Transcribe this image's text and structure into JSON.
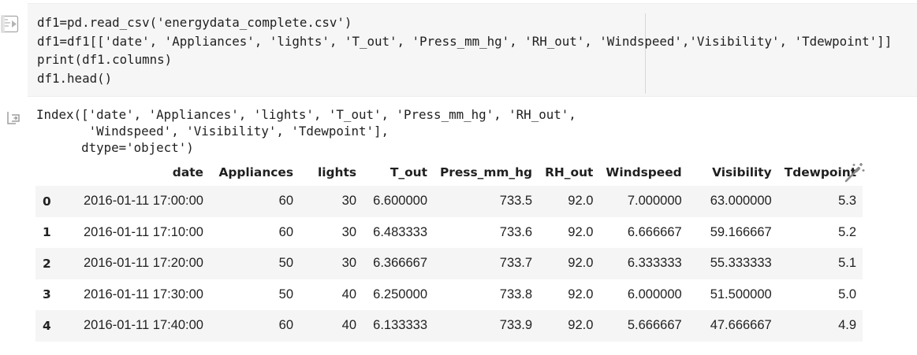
{
  "code_cell": {
    "lines": [
      "df1=pd.read_csv('energydata_complete.csv')",
      "df1=df1[['date', 'Appliances', 'lights', 'T_out', 'Press_mm_hg', 'RH_out', 'Windspeed','Visibility', 'Tdewpoint']]",
      "print(df1.columns)",
      "df1.head()"
    ]
  },
  "output": {
    "text_lines": [
      "Index(['date', 'Appliances', 'lights', 'T_out', 'Press_mm_hg', 'RH_out',",
      "       'Windspeed', 'Visibility', 'Tdewpoint'],",
      "      dtype='object')"
    ],
    "table": {
      "columns": [
        "",
        "date",
        "Appliances",
        "lights",
        "T_out",
        "Press_mm_hg",
        "RH_out",
        "Windspeed",
        "Visibility",
        "Tdewpoint"
      ],
      "rows": [
        [
          "0",
          "2016-01-11 17:00:00",
          "60",
          "30",
          "6.600000",
          "733.5",
          "92.0",
          "7.000000",
          "63.000000",
          "5.3"
        ],
        [
          "1",
          "2016-01-11 17:10:00",
          "60",
          "30",
          "6.483333",
          "733.6",
          "92.0",
          "6.666667",
          "59.166667",
          "5.2"
        ],
        [
          "2",
          "2016-01-11 17:20:00",
          "50",
          "30",
          "6.366667",
          "733.7",
          "92.0",
          "6.333333",
          "55.333333",
          "5.1"
        ],
        [
          "3",
          "2016-01-11 17:30:00",
          "50",
          "40",
          "6.250000",
          "733.8",
          "92.0",
          "6.000000",
          "51.500000",
          "5.0"
        ],
        [
          "4",
          "2016-01-11 17:40:00",
          "60",
          "40",
          "6.133333",
          "733.9",
          "92.0",
          "5.666667",
          "47.666667",
          "4.9"
        ]
      ]
    }
  },
  "icons": {
    "run": "run-cell-icon",
    "output": "output-arrow-icon",
    "wand": "magic-wand-icon"
  },
  "colors": {
    "editor_bg": "#f6f6f6",
    "row_stripe": "#f5f5f5",
    "icon_gray": "#9e9e9e"
  }
}
